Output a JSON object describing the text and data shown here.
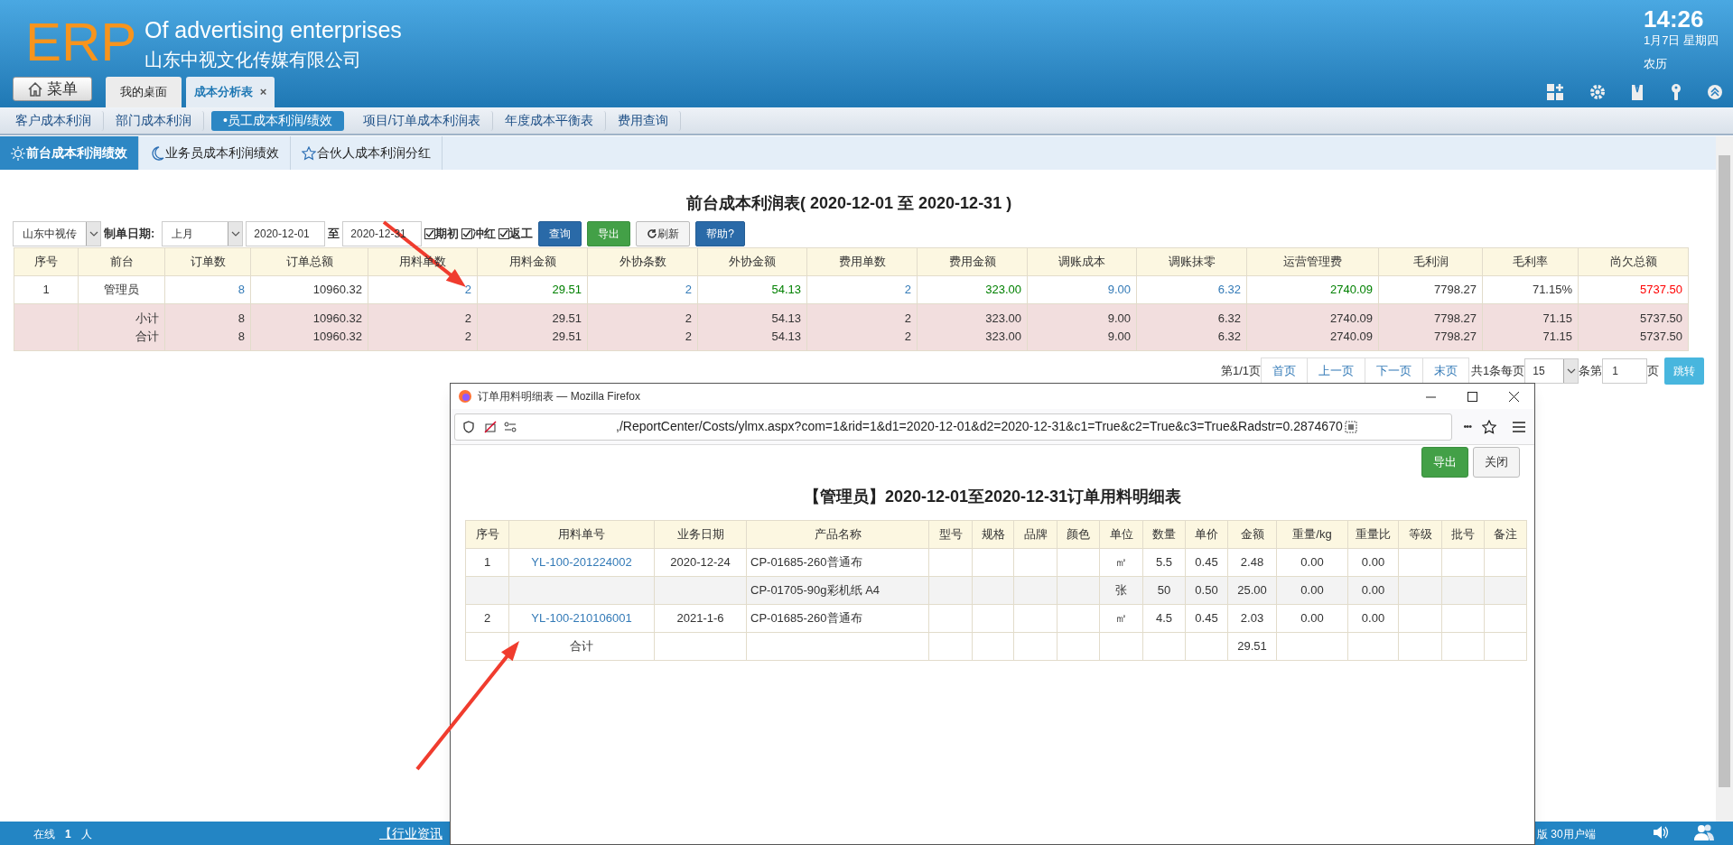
{
  "header": {
    "logo": "ERP",
    "title_en": "Of advertising enterprises",
    "title_cn": "山东中视文化传媒有限公司",
    "time": "14:26",
    "date": "1月7日 星期四",
    "lunar": "农历"
  },
  "menu_button": "菜单",
  "tabs": [
    {
      "label": "我的桌面",
      "selected": false
    },
    {
      "label": "成本分析表",
      "selected": true,
      "close": "×"
    }
  ],
  "subnav": [
    {
      "label": "客户成本利润",
      "selected": false
    },
    {
      "label": "部门成本利润",
      "selected": false
    },
    {
      "label": "•员工成本利润/绩效",
      "selected": true
    },
    {
      "label": "项目/订单成本利润表",
      "selected": false
    },
    {
      "label": "年度成本平衡表",
      "selected": false
    },
    {
      "label": "费用查询",
      "selected": false
    }
  ],
  "subtabs": [
    {
      "label": "前台成本利润绩效",
      "selected": true
    },
    {
      "label": "业务员成本利润绩效",
      "selected": false
    },
    {
      "label": "合伙人成本利润分红",
      "selected": false
    }
  ],
  "report_title": "前台成本利润表( 2020-12-01 至 2020-12-31 )",
  "toolbar": {
    "company": "山东中视传",
    "date_label": "制单日期:",
    "period": "上月",
    "from": "2020-12-01",
    "to_label": "至",
    "to": "2020-12-31",
    "checks": [
      {
        "label": "期初",
        "checked": true
      },
      {
        "label": "冲红",
        "checked": true
      },
      {
        "label": "返工",
        "checked": true
      }
    ],
    "buttons": [
      {
        "label": "查询",
        "kind": "primary"
      },
      {
        "label": "导出",
        "kind": "success"
      },
      {
        "label": "刷新",
        "kind": "refresh"
      },
      {
        "label": "帮助?",
        "kind": "primary"
      }
    ]
  },
  "table": {
    "columns": [
      "序号",
      "前台",
      "订单数",
      "订单总额",
      "用料单数",
      "用料金额",
      "外协条数",
      "外协金额",
      "费用单数",
      "费用金额",
      "调账成本",
      "调账抹零",
      "运营管理费",
      "毛利润",
      "毛利率",
      "尚欠总额"
    ],
    "rows": [
      {
        "kind": "data",
        "cells": [
          {
            "text": "1"
          },
          {
            "text": "管理员"
          },
          {
            "text": "8",
            "color": "#337ab7"
          },
          {
            "text": "10960.32"
          },
          {
            "text": "2",
            "color": "#337ab7"
          },
          {
            "text": "29.51",
            "color": "#008000"
          },
          {
            "text": "2",
            "color": "#337ab7"
          },
          {
            "text": "54.13",
            "color": "#008000"
          },
          {
            "text": "2",
            "color": "#337ab7"
          },
          {
            "text": "323.00",
            "color": "#008000"
          },
          {
            "text": "9.00",
            "color": "#337ab7"
          },
          {
            "text": "6.32",
            "color": "#337ab7"
          },
          {
            "text": "2740.09",
            "color": "#008000"
          },
          {
            "text": "7798.27"
          },
          {
            "text": "71.15%"
          },
          {
            "text": "5737.50",
            "color": "#ff0000"
          }
        ]
      },
      {
        "kind": "total",
        "cells": [
          {
            "text": ""
          },
          {
            "text": "小计"
          },
          {
            "text": "8"
          },
          {
            "text": "10960.32"
          },
          {
            "text": "2"
          },
          {
            "text": "29.51"
          },
          {
            "text": "2"
          },
          {
            "text": "54.13"
          },
          {
            "text": "2"
          },
          {
            "text": "323.00"
          },
          {
            "text": "9.00"
          },
          {
            "text": "6.32"
          },
          {
            "text": "2740.09"
          },
          {
            "text": "7798.27"
          },
          {
            "text": "71.15"
          },
          {
            "text": "5737.50"
          }
        ]
      },
      {
        "kind": "total",
        "cells": [
          {
            "text": ""
          },
          {
            "text": "合计"
          },
          {
            "text": "8"
          },
          {
            "text": "10960.32"
          },
          {
            "text": "2"
          },
          {
            "text": "29.51"
          },
          {
            "text": "2"
          },
          {
            "text": "54.13"
          },
          {
            "text": "2"
          },
          {
            "text": "323.00"
          },
          {
            "text": "9.00"
          },
          {
            "text": "6.32"
          },
          {
            "text": "2740.09"
          },
          {
            "text": "7798.27"
          },
          {
            "text": "71.15"
          },
          {
            "text": "5737.50"
          }
        ]
      }
    ]
  },
  "pager": {
    "page_info": "第1/1页",
    "links": [
      "首页",
      "上一页",
      "下一页",
      "末页"
    ],
    "total": "共1条每页",
    "page_size": "15",
    "goto_label": "条第",
    "page": "1",
    "page_suffix": "页",
    "jump": "跳转"
  },
  "popup": {
    "title": "订单用料明细表 — Mozilla Firefox",
    "url": ",/ReportCenter/Costs/ylmx.aspx?com=1&rid=1&d1=2020-12-01&d2=2020-12-31&c1=True&c2=True&c3=True&Radstr=0.2874670",
    "menu": "•••",
    "buttons": [
      {
        "label": "导出",
        "kind": "success"
      },
      {
        "label": "关闭",
        "kind": "default"
      }
    ],
    "heading": "【管理员】2020-12-01至2020-12-31订单用料明细表",
    "columns": [
      "序号",
      "用料单号",
      "业务日期",
      "产品名称",
      "型号",
      "规格",
      "品牌",
      "颜色",
      "单位",
      "数量",
      "单价",
      "金额",
      "重量/kg",
      "重量比",
      "等级",
      "批号",
      "备注"
    ],
    "rows": [
      {
        "striped": false,
        "cells": [
          "1",
          {
            "text": "YL-100-201224002",
            "kind": "link"
          },
          "2020-12-24",
          "CP-01685-260普通布",
          "",
          "",
          "",
          "",
          "㎡",
          "5.5",
          "0.45",
          "2.48",
          "0.00",
          "0.00",
          "",
          "",
          ""
        ]
      },
      {
        "striped": true,
        "cells": [
          "",
          "",
          "",
          "CP-01705-90g彩机纸 A4",
          "",
          "",
          "",
          "",
          "张",
          "50",
          "0.50",
          "25.00",
          "0.00",
          "0.00",
          "",
          "",
          ""
        ]
      },
      {
        "striped": false,
        "cells": [
          "2",
          {
            "text": "YL-100-210106001",
            "kind": "link"
          },
          "2021-1-6",
          "CP-01685-260普通布",
          "",
          "",
          "",
          "",
          "㎡",
          "4.5",
          "0.45",
          "2.03",
          "0.00",
          "0.00",
          "",
          "",
          ""
        ]
      },
      {
        "striped": false,
        "cells": [
          "",
          "合计",
          "",
          "",
          "",
          "",
          "",
          "",
          "",
          "",
          "",
          "29.51",
          "",
          "",
          "",
          "",
          ""
        ]
      }
    ]
  },
  "status_bar": {
    "online_label": "在线",
    "online_count": "1",
    "online_unit": "人",
    "news": "【行业资讯",
    "edition": "版 30用户端"
  }
}
